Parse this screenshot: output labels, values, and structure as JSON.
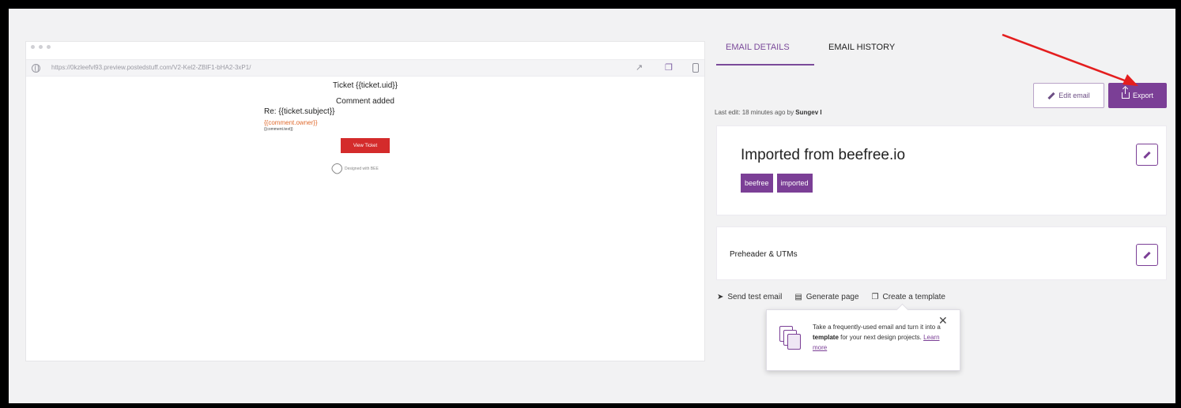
{
  "preview": {
    "url": "https://0kzleefvl93.preview.postedstuff.com/V2-Kel2-ZBlF1-bHA2-3xP1/",
    "toolbar_icons": [
      "external-link-icon",
      "copy-icon",
      "mobile-icon"
    ],
    "email": {
      "ticket_title": "Ticket {{ticket.uid}}",
      "comment_added": "Comment added",
      "re_subject": "Re: {{ticket.subject}}",
      "comment_owner": "{{comment.owner}}",
      "comment_text": "{{comment.text}}",
      "view_ticket": "View Ticket",
      "designed_with": "Designed with BEE"
    }
  },
  "tabs": [
    {
      "label": "EMAIL DETAILS",
      "active": true
    },
    {
      "label": "EMAIL HISTORY",
      "active": false
    }
  ],
  "last_edit": {
    "prefix": "Last edit: 18 minutes ago by",
    "user": "Sungev I"
  },
  "buttons": {
    "edit_email": "Edit email",
    "export": "Export"
  },
  "email_card": {
    "name": "Imported from beefree.io",
    "tags": [
      "beefree",
      "imported"
    ]
  },
  "preheader_card": {
    "label": "Preheader & UTMs"
  },
  "actions": [
    {
      "label": "Send test email",
      "icon": "send-icon"
    },
    {
      "label": "Generate page",
      "icon": "page-icon"
    },
    {
      "label": "Create a template",
      "icon": "template-icon"
    }
  ],
  "popover": {
    "text_before": "Take a frequently-used email and turn it into a ",
    "text_bold": "template",
    "text_after": " for your next design projects. ",
    "link": "Learn more"
  },
  "colors": {
    "accent": "#7b3f96",
    "view_ticket_button": "#d42b2b",
    "annotation_arrow": "#e41e1e"
  }
}
